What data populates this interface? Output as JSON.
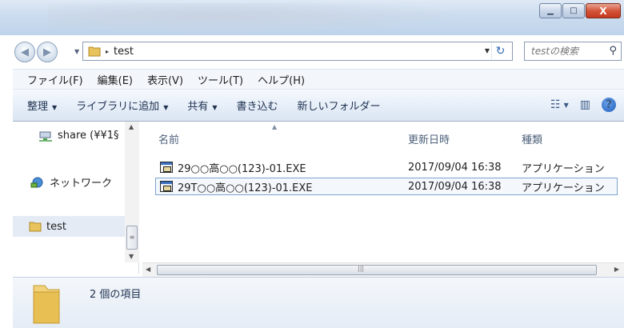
{
  "window": {
    "minimize_glyph": "▁",
    "maximize_glyph": "□",
    "close_glyph": "X"
  },
  "address": {
    "crumbs": [
      "test"
    ],
    "separator": "▸"
  },
  "search": {
    "placeholder": "testの検索"
  },
  "menu": {
    "items": [
      "ファイル(F)",
      "編集(E)",
      "表示(V)",
      "ツール(T)",
      "ヘルプ(H)"
    ]
  },
  "toolbar": {
    "organize": "整理",
    "include_library": "ライブラリに追加",
    "share": "共有",
    "burn": "書き込む",
    "new_folder": "新しいフォルダー",
    "dropdown_glyph": "▼",
    "view_icon": "view-options-icon",
    "preview_icon": "preview-pane-icon",
    "help_glyph": "?"
  },
  "navigation": {
    "items": [
      {
        "label": "share (¥¥1§",
        "icon": "network-drive-icon"
      },
      {
        "label": "ネットワーク",
        "icon": "network-icon"
      },
      {
        "label": "test",
        "icon": "folder-icon",
        "selected": true
      }
    ]
  },
  "columns": {
    "name": "名前",
    "date_modified": "更新日時",
    "type": "種類"
  },
  "files": [
    {
      "name": "29○○高○○(123)-01.EXE",
      "date_modified": "2017/09/04 16:38",
      "type": "アプリケーション",
      "selected": false
    },
    {
      "name": "29T○○高○○(123)-01.EXE",
      "date_modified": "2017/09/04 16:38",
      "type": "アプリケーション",
      "selected": true
    }
  ],
  "status": {
    "item_count": "2 個の項目"
  },
  "colors": {
    "accent": "#2f67b2",
    "selection_border": "#7da2ce",
    "titlebar": "#cbdcee"
  }
}
